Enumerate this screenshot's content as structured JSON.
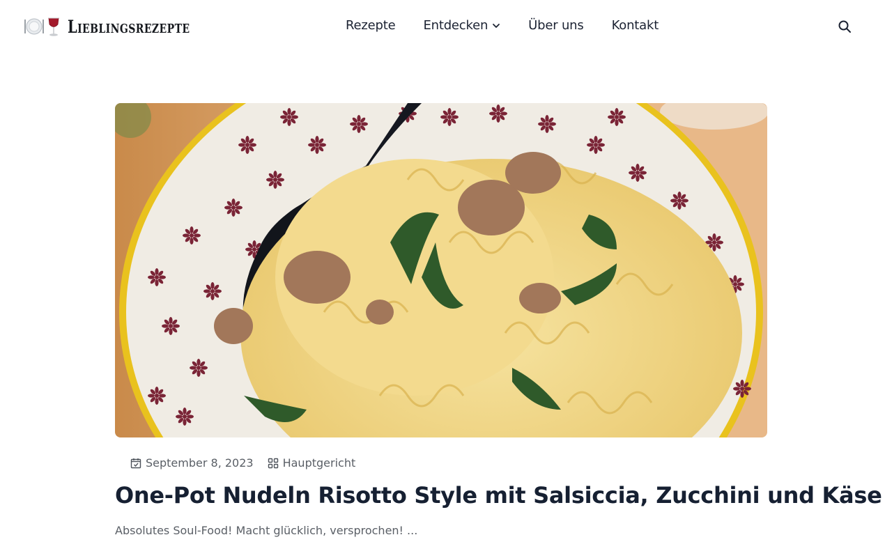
{
  "site": {
    "logo_text": "Lieblingsrezepte",
    "logo_icons": [
      "plate-cutlery-icon",
      "wine-glass-icon"
    ]
  },
  "nav": {
    "items": [
      {
        "label": "Rezepte"
      },
      {
        "label": "Entdecken",
        "has_dropdown": true
      },
      {
        "label": "Über uns"
      },
      {
        "label": "Kontakt"
      }
    ],
    "search_icon": "search-icon"
  },
  "post": {
    "image_description": "Bowl of cavatappi pasta with salsiccia, zucchini and cheese",
    "date": "September 8, 2023",
    "category": "Hauptgericht",
    "title": "One-Pot Nudeln Risotto Style mit Salsiccia, Zucchini und Käse",
    "excerpt": "Absolutes Soul-Food! Macht glücklich, versprochen! ..."
  },
  "colors": {
    "text": "#1c2333",
    "meta": "#5a5f66",
    "bowl_rim": "#e9c21e",
    "bowl_pattern": "#7a2436"
  }
}
